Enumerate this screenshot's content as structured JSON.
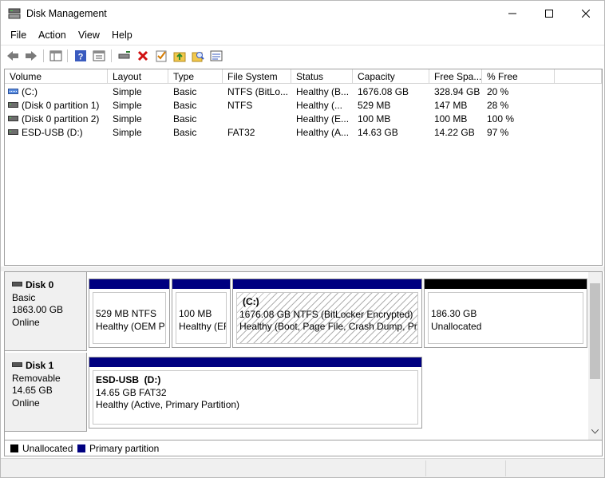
{
  "window": {
    "title": "Disk Management",
    "icon": "disk-management-icon"
  },
  "menu": [
    "File",
    "Action",
    "View",
    "Help"
  ],
  "toolbar": [
    "back-icon",
    "forward-icon",
    "show-hide-console-tree-icon",
    "help-icon",
    "properties-icon",
    "connect-drive-icon",
    "delete-icon",
    "check-icon",
    "up-folder-icon",
    "search-icon",
    "settings-icon"
  ],
  "list": {
    "columns": [
      "Volume",
      "Layout",
      "Type",
      "File System",
      "Status",
      "Capacity",
      "Free Spa...",
      "% Free"
    ],
    "rows": [
      {
        "volume": "(C:)",
        "layout": "Simple",
        "type": "Basic",
        "fs": "NTFS (BitLo...",
        "status": "Healthy (B...",
        "capacity": "1676.08 GB",
        "free": "328.94 GB",
        "pct": "20 %"
      },
      {
        "volume": "(Disk 0 partition 1)",
        "layout": "Simple",
        "type": "Basic",
        "fs": "NTFS",
        "status": "Healthy (...",
        "capacity": "529 MB",
        "free": "147 MB",
        "pct": "28 %"
      },
      {
        "volume": "(Disk 0 partition 2)",
        "layout": "Simple",
        "type": "Basic",
        "fs": "",
        "status": "Healthy (E...",
        "capacity": "100 MB",
        "free": "100 MB",
        "pct": "100 %"
      },
      {
        "volume": "ESD-USB (D:)",
        "layout": "Simple",
        "type": "Basic",
        "fs": "FAT32",
        "status": "Healthy (A...",
        "capacity": "14.63 GB",
        "free": "14.22 GB",
        "pct": "97 %"
      }
    ]
  },
  "disks": [
    {
      "name": "Disk 0",
      "kind": "Basic",
      "size": "1863.00 GB",
      "state": "Online",
      "partitions": [
        {
          "line1": "",
          "line2": "529 MB NTFS",
          "line3": "Healthy (OEM Pa"
        },
        {
          "line1": "",
          "line2": "100 MB",
          "line3": "Healthy (EF"
        },
        {
          "line1": "(C:)",
          "line2": "1676.08 GB NTFS (BitLocker Encrypted)",
          "line3": "Healthy (Boot, Page File, Crash Dump, Prir"
        },
        {
          "line1": "",
          "line2": "186.30 GB",
          "line3": "Unallocated"
        }
      ]
    },
    {
      "name": "Disk 1",
      "kind": "Removable",
      "size": "14.65 GB",
      "state": "Online",
      "partitions": [
        {
          "line1": "ESD-USB  (D:)",
          "line2": "14.65 GB FAT32",
          "line3": "Healthy (Active, Primary Partition)"
        }
      ]
    }
  ],
  "legend": [
    {
      "label": "Unallocated",
      "color": "#000000"
    },
    {
      "label": "Primary partition",
      "color": "#000080"
    }
  ],
  "colors": {
    "primary": "#000080",
    "unallocated": "#000000"
  }
}
